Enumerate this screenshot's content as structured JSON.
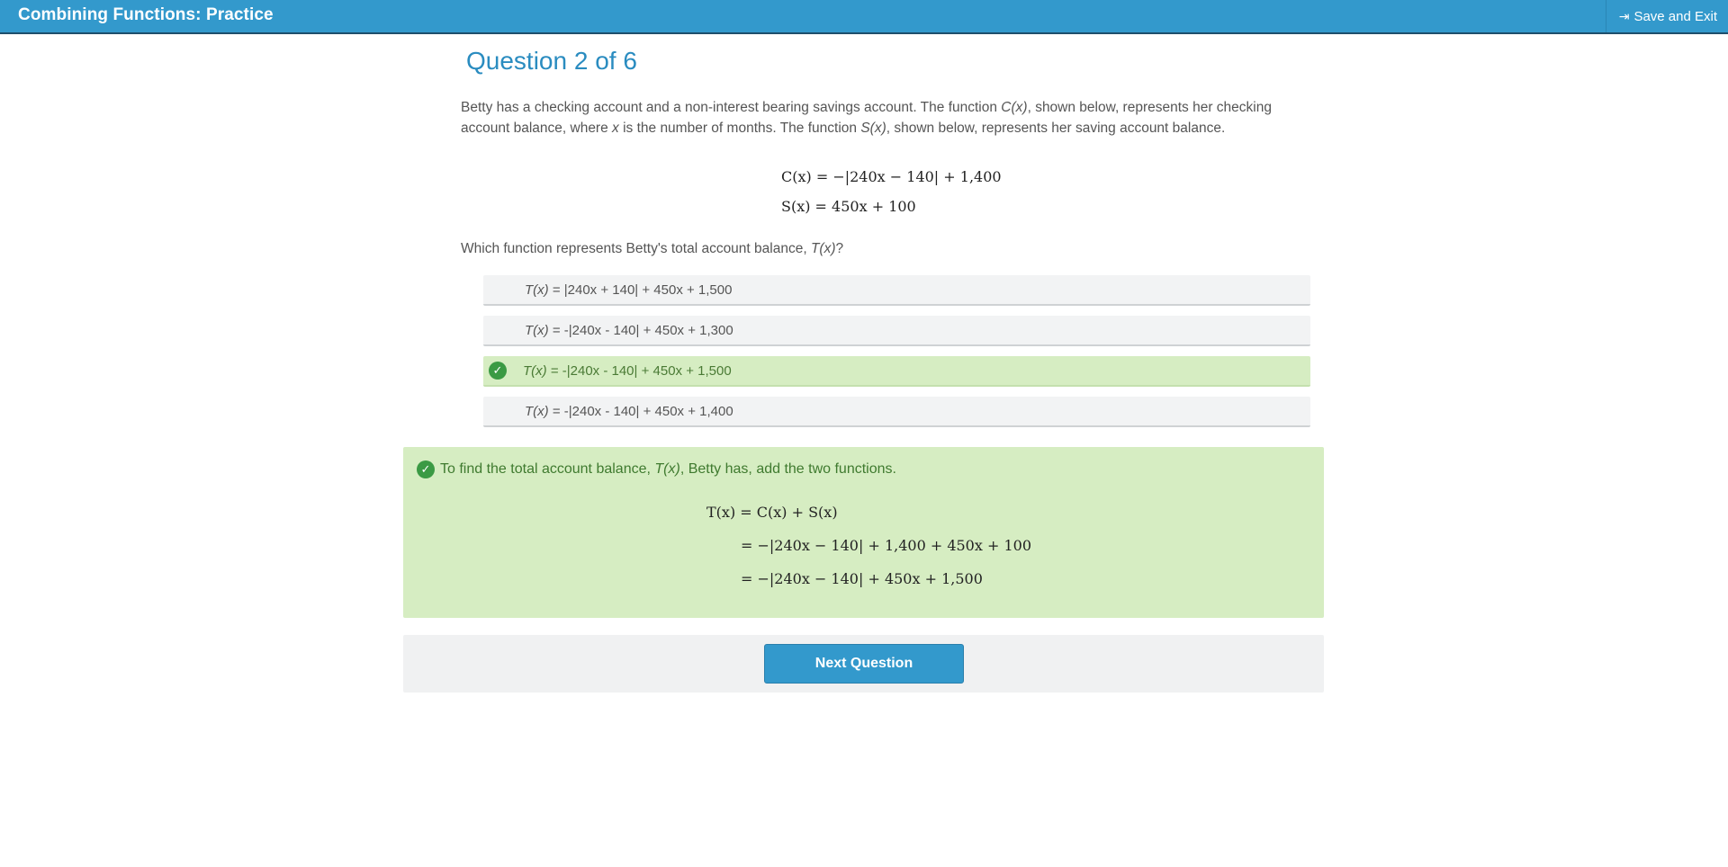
{
  "header": {
    "title": "Combining Functions: Practice",
    "save_exit_label": "Save and Exit"
  },
  "question": {
    "title": "Question 2 of 6",
    "prompt_part1": "Betty has a checking account and a non-interest bearing savings account. The function ",
    "prompt_fn_c": "C(x)",
    "prompt_part2": ", shown below, represents her checking account balance, where ",
    "prompt_var": "x",
    "prompt_part3": " is the number of months. The function ",
    "prompt_fn_s": "S(x)",
    "prompt_part4": ", shown below, represents her saving account balance.",
    "equation_c": "C(x) = −|240x − 140| + 1,400",
    "equation_s": "S(x) = 450x + 100",
    "ask_part1": "Which function represents Betty's total account balance, ",
    "ask_fn": "T(x)",
    "ask_part2": "?"
  },
  "choices": [
    {
      "fn": "T(x)",
      "expr": " = |240x + 140| + 450x + 1,500",
      "selected": false
    },
    {
      "fn": "T(x)",
      "expr": " = -|240x - 140| + 450x + 1,300",
      "selected": false
    },
    {
      "fn": "T(x)",
      "expr": " = -|240x - 140| + 450x + 1,500",
      "selected": true
    },
    {
      "fn": "T(x)",
      "expr": " = -|240x - 140| + 450x + 1,400",
      "selected": false
    }
  ],
  "feedback": {
    "part1": "To find the total account balance, ",
    "fn": "T(x)",
    "part2": ", Betty has, add the two functions.",
    "line1": "T(x) = C(x) + S(x)",
    "line2": "= −|240x − 140| + 1,400 + 450x + 100",
    "line3": "= −|240x − 140| + 450x + 1,500"
  },
  "next_button_label": "Next Question",
  "colors": {
    "header_bg": "#3399cc",
    "title_blue": "#2a8cc0",
    "correct_bg": "#d6edc2",
    "check_green": "#3b9a44"
  }
}
